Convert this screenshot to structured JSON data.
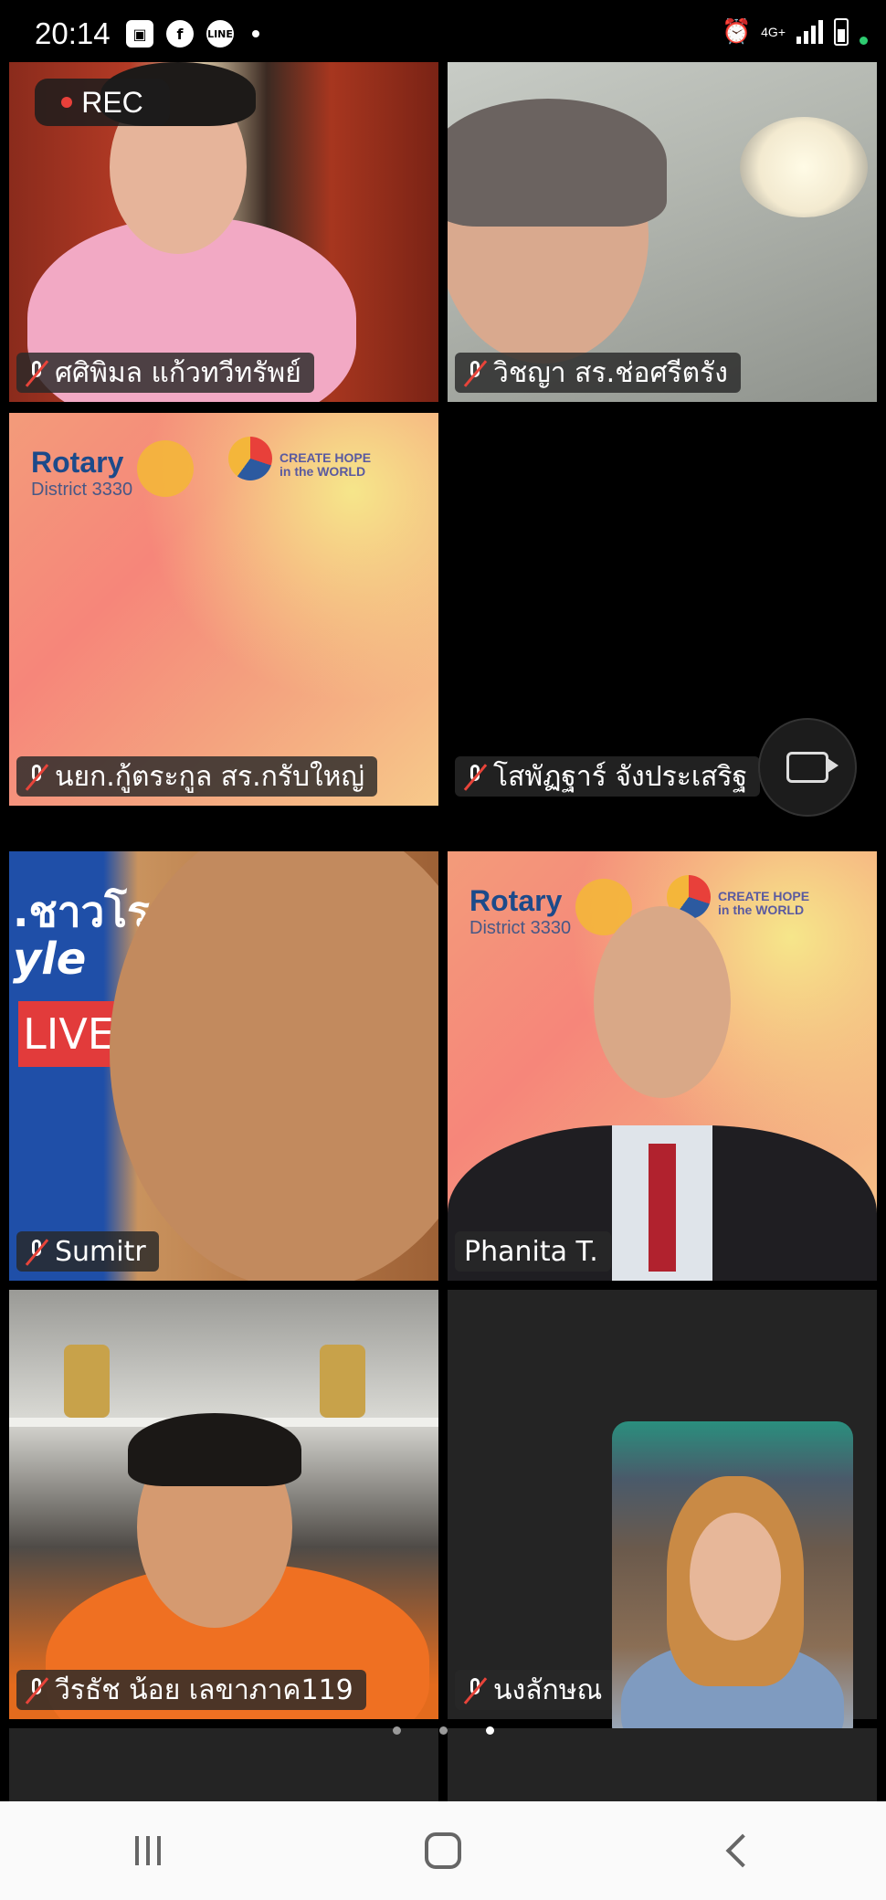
{
  "status_bar": {
    "time": "20:14",
    "network": "4G+",
    "notification_icons": [
      "gallery-icon",
      "facebook-icon",
      "line-icon"
    ],
    "status_icons": [
      "alarm-icon",
      "signal-icon",
      "battery-icon"
    ]
  },
  "recording": {
    "label": "REC"
  },
  "participants": [
    {
      "name": "ศศิพิมล แก้วทวีทรัพย์",
      "muted": true
    },
    {
      "name": "วิชญา สร.ช่อศรีตรัง",
      "muted": true
    },
    {
      "name": "นยก.กู้ตระกูล สร.กรับใหญ่",
      "muted": true
    },
    {
      "name": "โสพัฏฐาร์ จังประเสริฐ",
      "muted": true
    },
    {
      "name": "Sumitr",
      "muted": true
    },
    {
      "name": "Phanita T.",
      "muted": false
    },
    {
      "name": "วีรธัช น้อย เลขาภาค119",
      "muted": true
    },
    {
      "name": "นงลักษณ",
      "muted": true
    }
  ],
  "rotary_background": {
    "brand": "Rotary",
    "district": "District 3330",
    "slogan_line1": "CREATE HOPE",
    "slogan_line2": "in the WORLD"
  },
  "sumitr_background": {
    "text1": ".ชาวโร",
    "text2": "yle",
    "live": "LIVE"
  },
  "video_toggle": {
    "icon": "video-camera-icon"
  },
  "pagination": {
    "pages": 3,
    "active": 3
  },
  "nav_bar": {
    "buttons": [
      "recent-apps",
      "home",
      "back"
    ]
  }
}
